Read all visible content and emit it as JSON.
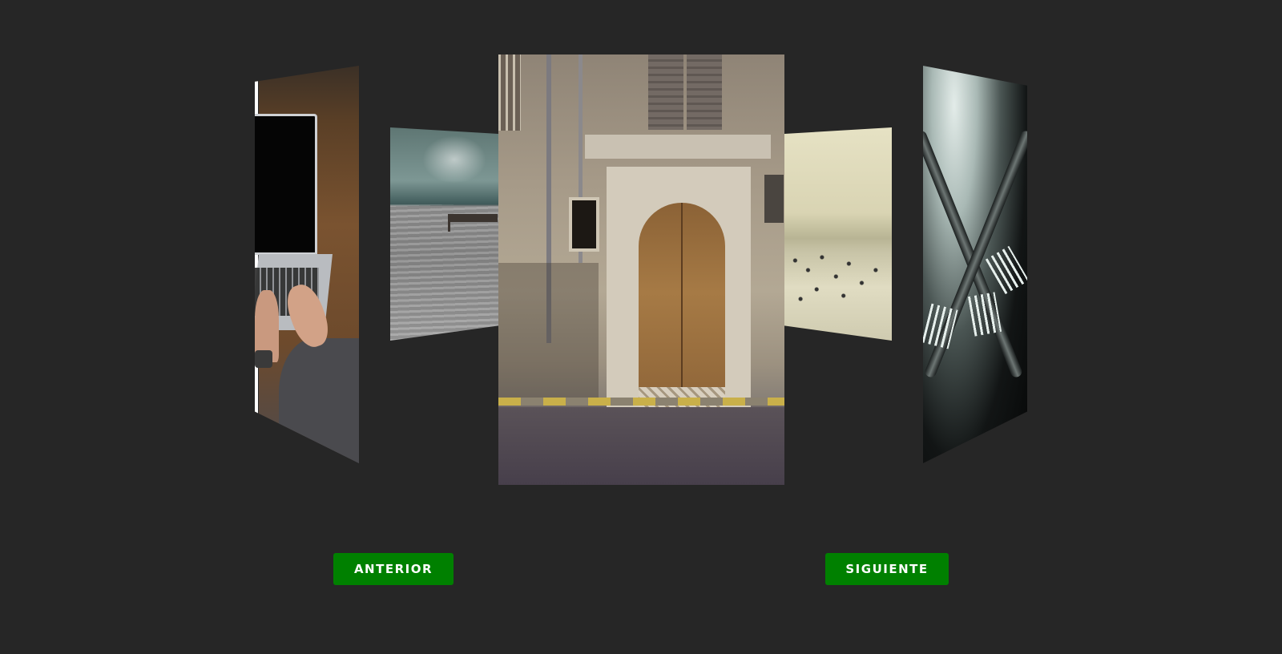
{
  "carousel": {
    "slides": [
      {
        "subject": "laptop-typing-photo",
        "position": "far-left"
      },
      {
        "subject": "pier-water-photo",
        "position": "left"
      },
      {
        "subject": "wooden-door-facade-photo",
        "position": "center"
      },
      {
        "subject": "beach-crowd-photo",
        "position": "right"
      },
      {
        "subject": "forks-photo",
        "position": "far-right"
      }
    ]
  },
  "controls": {
    "prev_label": "ANTERIOR",
    "next_label": "SIGUIENTE"
  },
  "colors": {
    "background": "#262626",
    "button": "#008000",
    "button_text": "#ffffff"
  }
}
